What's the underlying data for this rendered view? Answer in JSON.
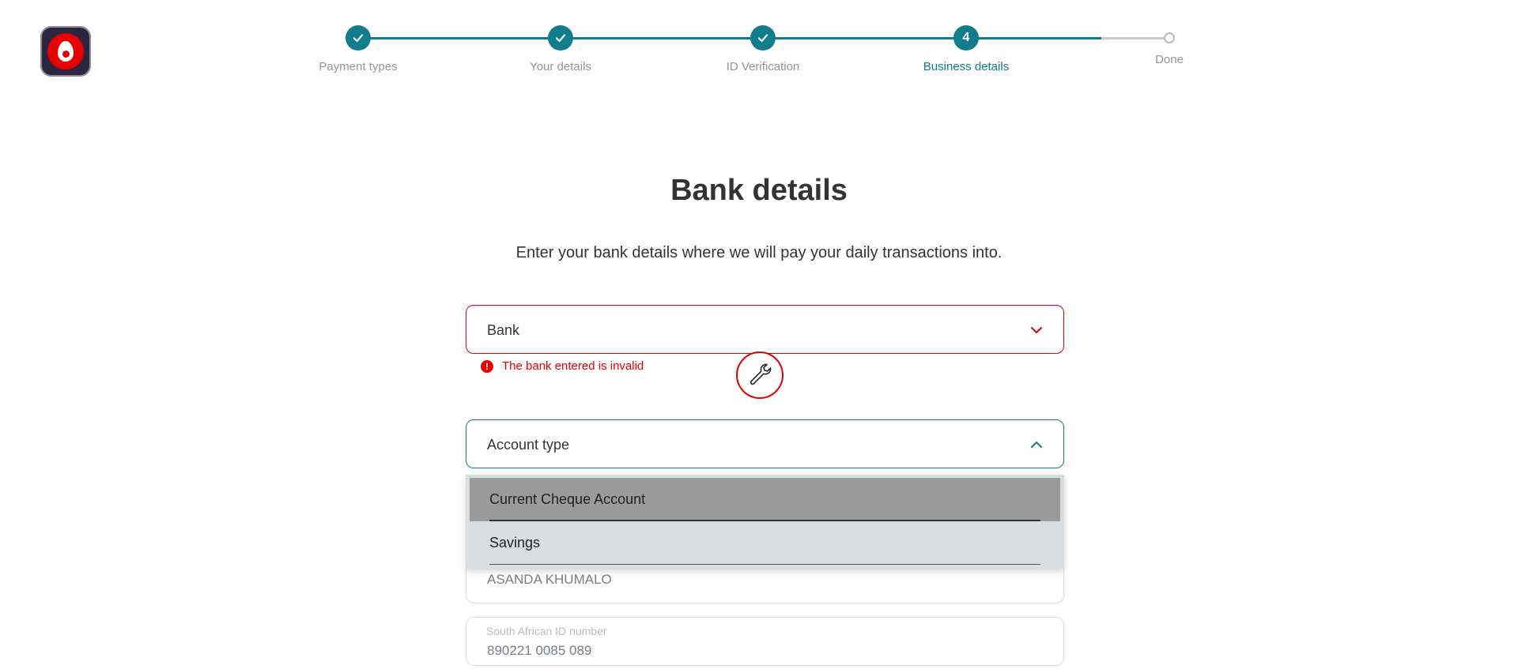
{
  "brand": {
    "accent": "#0f7d8c",
    "error": "#e60000"
  },
  "stepper": {
    "steps": [
      {
        "label": "Payment types",
        "state": "complete",
        "icon": "check-icon"
      },
      {
        "label": "Your details",
        "state": "complete",
        "icon": "check-icon"
      },
      {
        "label": "ID Verification",
        "state": "complete",
        "icon": "check-icon"
      },
      {
        "label": "Business details",
        "state": "active",
        "number": "4"
      },
      {
        "label": "Done",
        "state": "pending"
      }
    ]
  },
  "page": {
    "title": "Bank details",
    "subtitle": "Enter your bank details where we will pay your daily transactions into."
  },
  "form": {
    "bank": {
      "label": "Bank",
      "error": "The bank entered is invalid"
    },
    "account_type": {
      "label": "Account type",
      "options": [
        "Current Cheque Account",
        "Savings"
      ]
    },
    "account_holder": {
      "value": "ASANDA KHUMALO"
    },
    "id_number": {
      "label": "South African ID number",
      "value": "890221 0085 089"
    }
  }
}
